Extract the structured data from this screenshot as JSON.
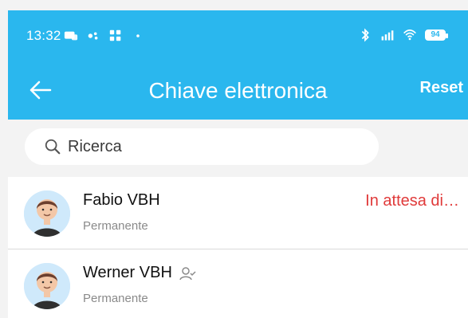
{
  "status_bar": {
    "time": "13:32",
    "battery": "94"
  },
  "header": {
    "title": "Chiave elettronica",
    "reset": "Reset"
  },
  "search": {
    "placeholder": "Ricerca"
  },
  "list": {
    "items": [
      {
        "name": "Fabio VBH",
        "subtitle": "Permanente",
        "status": "In attesa di…"
      },
      {
        "name": "Werner VBH",
        "subtitle": "Permanente"
      }
    ]
  },
  "colors": {
    "primary": "#2ab7ee",
    "status_red": "#e03a3a"
  }
}
